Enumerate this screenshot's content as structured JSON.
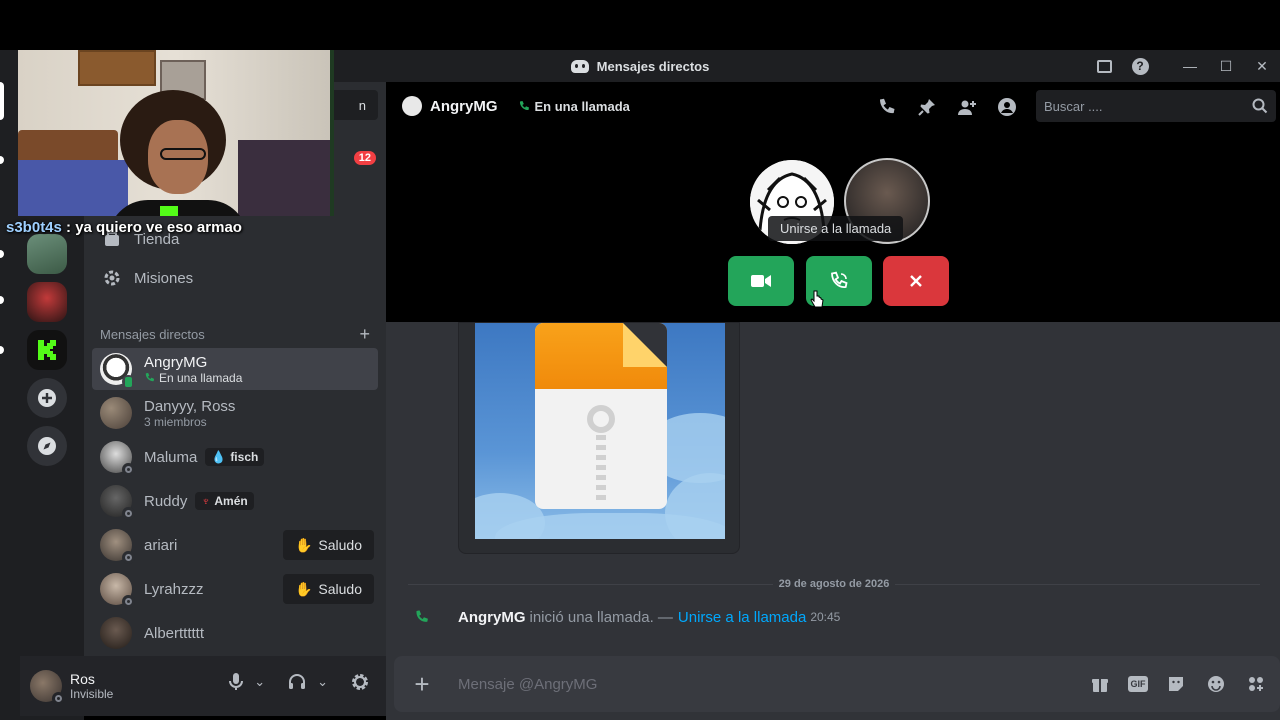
{
  "window": {
    "title": "Mensajes directos"
  },
  "sidebar": {
    "search_fragment": "n",
    "unread_count": "12",
    "nav": [
      {
        "label": "Tienda",
        "icon": "shop-icon"
      },
      {
        "label": "Misiones",
        "icon": "quests-icon"
      }
    ],
    "dm_header": "Mensajes directos",
    "dms": [
      {
        "name": "AngryMG",
        "sub": "En una llamada",
        "active": true
      },
      {
        "name": "Danyyy, Ross",
        "sub": "3 miembros"
      },
      {
        "name": "Maluma",
        "tag": "fisch"
      },
      {
        "name": "Ruddy",
        "tag": "Amén"
      },
      {
        "name": "ariari",
        "action": "Saludo"
      },
      {
        "name": "Lyrahzzz",
        "action": "Saludo"
      },
      {
        "name": "Albertttttt"
      }
    ]
  },
  "user_panel": {
    "name": "Ros",
    "status": "Invisible"
  },
  "chat": {
    "header_name": "AngryMG",
    "header_status": "En una llamada",
    "search_placeholder": "Buscar ....",
    "call_tooltip": "Unirse a la llamada",
    "date_divider": "29 de agosto de 2026",
    "system_message": {
      "author": "AngryMG",
      "action": "inició una llamada. —",
      "link": "Unirse a la llamada",
      "time": "20:45"
    },
    "composer_placeholder": "Mensaje @AngryMG",
    "gif_label": "GIF"
  },
  "stream_overlay": {
    "user": "s3b0t4s",
    "message": " : ya quiero ve eso armao"
  },
  "colors": {
    "accept": "#23a55a",
    "decline": "#da373c",
    "link": "#00a8fc",
    "kick": "#53fc18"
  }
}
